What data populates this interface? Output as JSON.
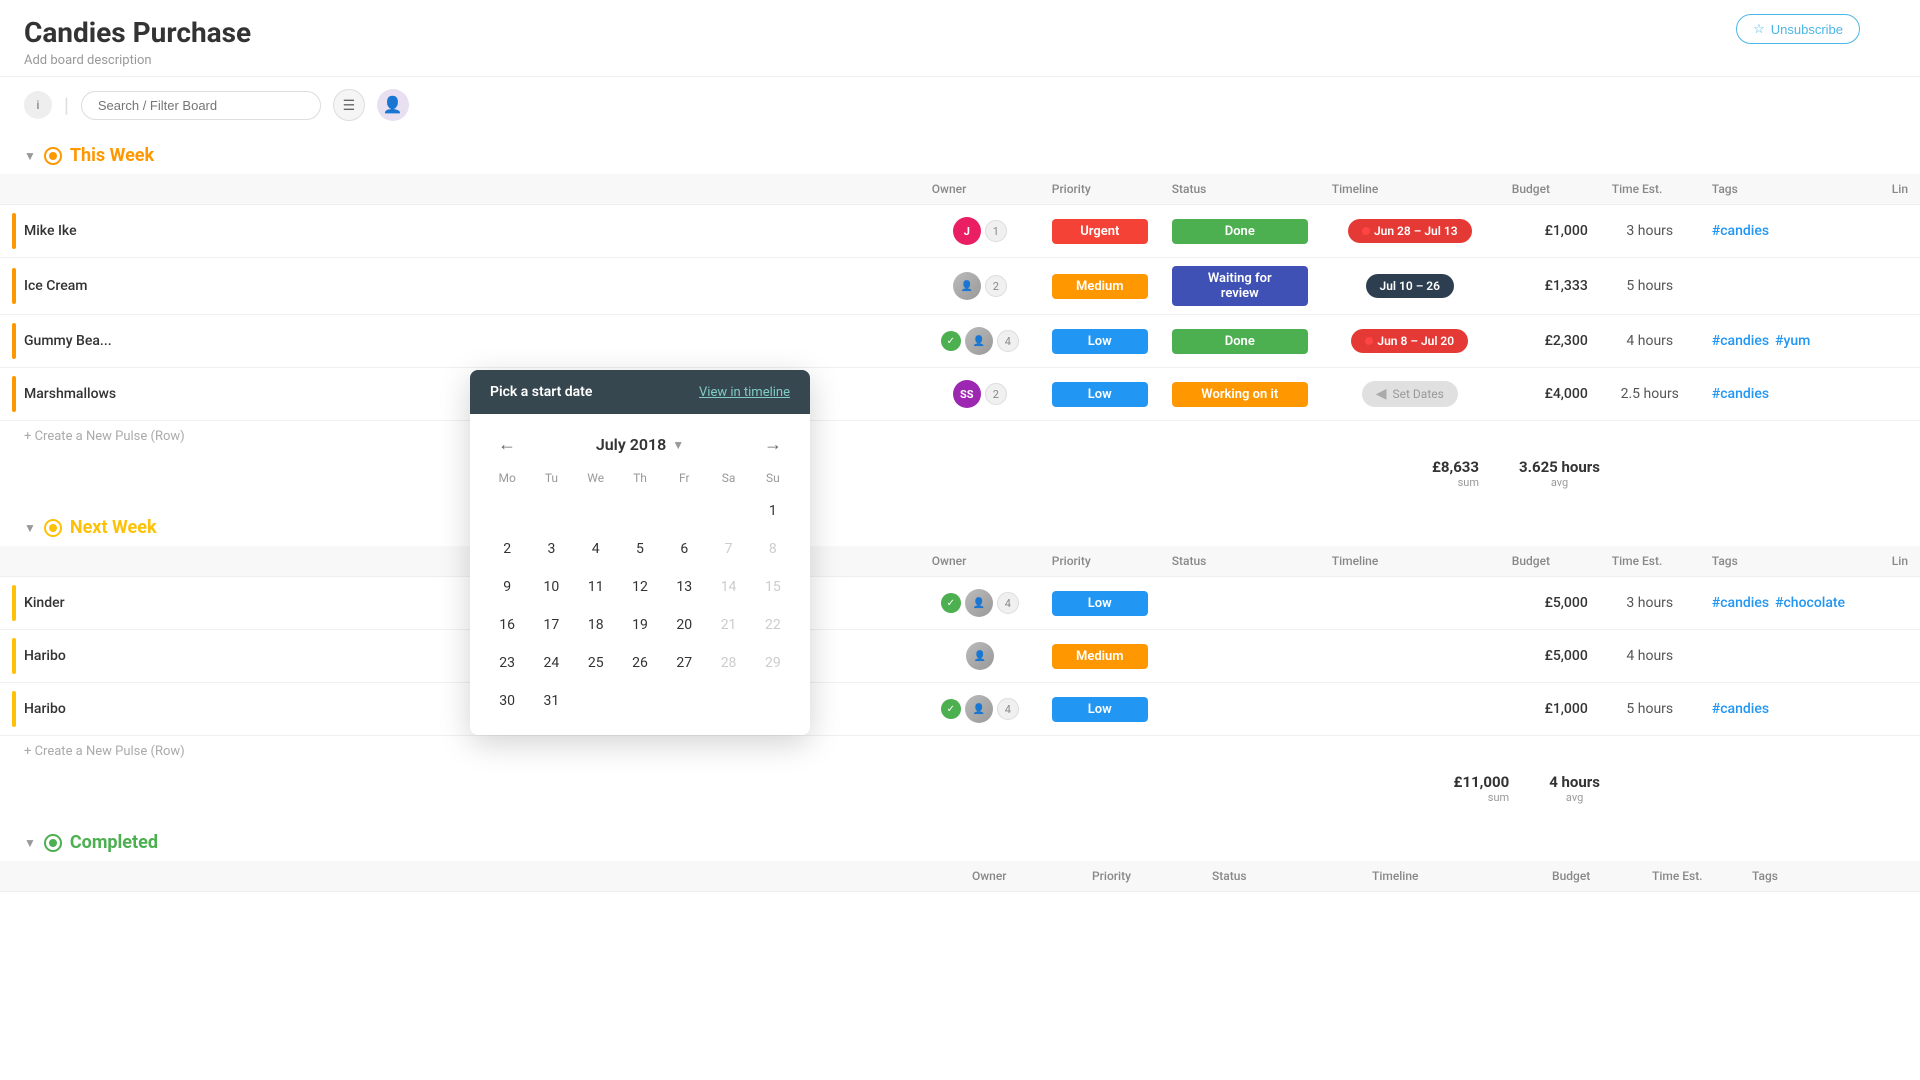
{
  "page": {
    "title": "Candies Purchase",
    "subtitle": "Add board description",
    "unsubscribe_label": "Unsubscribe"
  },
  "toolbar": {
    "search_placeholder": "Search / Filter Board"
  },
  "groups": [
    {
      "id": "this-week",
      "title": "This Week",
      "color": "orange",
      "columns": [
        "Owner",
        "Priority",
        "Status",
        "Timeline",
        "Budget",
        "Time Est.",
        "Tags",
        "Lin"
      ],
      "rows": [
        {
          "name": "Mike Ike",
          "owner_initial": "J",
          "owner_color": "j",
          "count": "1",
          "priority": "Urgent",
          "priority_class": "priority-urgent",
          "status": "Done",
          "status_class": "status-done",
          "timeline": "Jun 28 – Jul 13",
          "timeline_class": "timeline-red",
          "budget": "£1,000",
          "time": "3 hours",
          "tags": [
            "#candies"
          ],
          "has_check": false
        },
        {
          "name": "Ice Cream",
          "owner_photo": true,
          "count": "2",
          "priority": "Medium",
          "priority_class": "priority-medium",
          "status": "Waiting for review",
          "status_class": "status-waiting",
          "timeline": "Jul 10 – 26",
          "timeline_class": "timeline-dark",
          "budget": "£1,333",
          "time": "5 hours",
          "tags": [],
          "has_check": false
        },
        {
          "name": "Gummy Bea...",
          "owner_photo": true,
          "count": "4",
          "priority": "Low",
          "priority_class": "priority-low",
          "status": "Done",
          "status_class": "status-done",
          "timeline": "Jun 8 – Jul 20",
          "timeline_class": "timeline-red",
          "budget": "£2,300",
          "time": "4 hours",
          "tags": [
            "#candies",
            "#yum"
          ],
          "has_check": true
        },
        {
          "name": "Marshmallows",
          "owner_initial": "SS",
          "owner_color": "ss",
          "count": "2",
          "priority": "Low",
          "priority_class": "priority-low",
          "status": "Working on it",
          "status_class": "status-working",
          "timeline": "Set Dates",
          "timeline_class": "timeline-set",
          "budget": "£4,000",
          "time": "2.5 hours",
          "tags": [
            "#candies"
          ],
          "has_check": false
        }
      ],
      "summary": {
        "budget": "£8,633",
        "budget_label": "sum",
        "time": "3.625 hours",
        "time_label": "avg"
      }
    },
    {
      "id": "next-week",
      "title": "Next Week",
      "color": "yellow",
      "columns": [
        "Owner",
        "Priority",
        "Status",
        "Timeline",
        "Budget",
        "Time Est.",
        "Tags",
        "Lin"
      ],
      "rows": [
        {
          "name": "Kinder",
          "owner_photo": true,
          "count": "4",
          "priority": "Low",
          "priority_class": "priority-low",
          "status": "",
          "status_class": "",
          "timeline": "",
          "timeline_class": "",
          "budget": "£5,000",
          "time": "3 hours",
          "tags": [
            "#candies",
            "#chocolate"
          ],
          "has_check": true
        },
        {
          "name": "Haribo",
          "owner_photo": true,
          "count": "",
          "priority": "Medium",
          "priority_class": "priority-medium",
          "status": "",
          "status_class": "",
          "timeline": "",
          "timeline_class": "",
          "budget": "£5,000",
          "time": "4 hours",
          "tags": [],
          "has_check": false
        },
        {
          "name": "Haribo",
          "owner_photo": true,
          "count": "4",
          "priority": "Low",
          "priority_class": "priority-low",
          "status": "",
          "status_class": "",
          "timeline": "",
          "timeline_class": "",
          "budget": "£1,000",
          "time": "5 hours",
          "tags": [
            "#candies"
          ],
          "has_check": true
        }
      ],
      "summary": {
        "budget": "£11,000",
        "budget_label": "sum",
        "time": "4 hours",
        "time_label": "avg"
      }
    },
    {
      "id": "completed",
      "title": "Completed",
      "color": "green",
      "columns": [
        "Owner",
        "Priority",
        "Status",
        "Timeline",
        "Budget",
        "Time Est.",
        "Tags"
      ],
      "rows": [],
      "summary": null
    }
  ],
  "calendar": {
    "header_title": "Pick a start date",
    "view_timeline": "View in timeline",
    "month_label": "July 2018",
    "prev_arrow": "←",
    "next_arrow": "→",
    "day_headers": [
      "Mo",
      "Tu",
      "We",
      "Th",
      "Fr",
      "Sa",
      "Su"
    ],
    "weeks": [
      [
        "",
        "",
        "",
        "",
        "",
        "",
        "1"
      ],
      [
        "2",
        "3",
        "4",
        "5",
        "6",
        "7",
        "8"
      ],
      [
        "9",
        "10",
        "11",
        "12",
        "13",
        "14",
        "15"
      ],
      [
        "16",
        "17",
        "18",
        "19",
        "20",
        "21",
        "22"
      ],
      [
        "23",
        "24",
        "25",
        "26",
        "27",
        "28",
        "29"
      ],
      [
        "30",
        "31",
        "",
        "",
        "",
        "",
        ""
      ]
    ],
    "disabled_days": [
      "7",
      "8",
      "14",
      "15",
      "21",
      "22",
      "28",
      "29"
    ]
  }
}
